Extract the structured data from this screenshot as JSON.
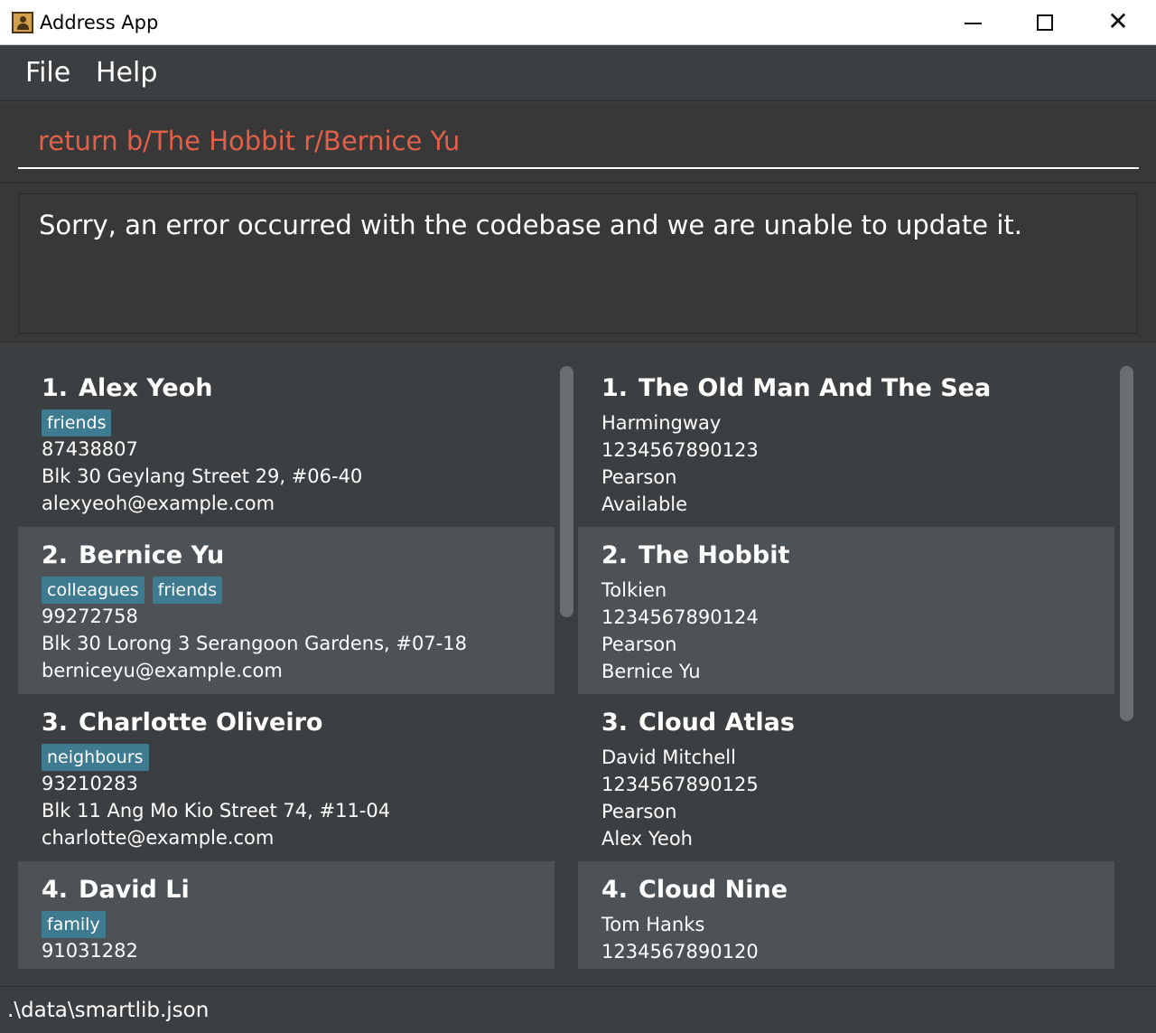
{
  "window": {
    "title": "Address App"
  },
  "menu": {
    "file": "File",
    "help": "Help"
  },
  "command": {
    "value": "return b/The Hobbit r/Bernice Yu"
  },
  "result": {
    "message": "Sorry, an error occurred with the codebase and we are unable to update it."
  },
  "persons": [
    {
      "index": "1.",
      "name": "Alex Yeoh",
      "tags": [
        "friends"
      ],
      "phone": "87438807",
      "address": "Blk 30 Geylang Street 29, #06-40",
      "email": "alexyeoh@example.com"
    },
    {
      "index": "2.",
      "name": "Bernice Yu",
      "tags": [
        "colleagues",
        "friends"
      ],
      "phone": "99272758",
      "address": "Blk 30 Lorong 3 Serangoon Gardens, #07-18",
      "email": "berniceyu@example.com"
    },
    {
      "index": "3.",
      "name": "Charlotte Oliveiro",
      "tags": [
        "neighbours"
      ],
      "phone": "93210283",
      "address": "Blk 11 Ang Mo Kio Street 74, #11-04",
      "email": "charlotte@example.com"
    },
    {
      "index": "4.",
      "name": "David Li",
      "tags": [
        "family"
      ],
      "phone": "91031282"
    }
  ],
  "books": [
    {
      "index": "1.",
      "title": "The Old Man And The Sea",
      "author": "Harmingway",
      "isbn": "1234567890123",
      "publisher": "Pearson",
      "status": "Available"
    },
    {
      "index": "2.",
      "title": "The Hobbit",
      "author": "Tolkien",
      "isbn": "1234567890124",
      "publisher": "Pearson",
      "status": "Bernice Yu"
    },
    {
      "index": "3.",
      "title": "Cloud Atlas",
      "author": "David Mitchell",
      "isbn": "1234567890125",
      "publisher": "Pearson",
      "status": "Alex Yeoh"
    },
    {
      "index": "4.",
      "title": "Cloud Nine",
      "author": "Tom Hanks",
      "isbn": "1234567890120"
    }
  ],
  "status": {
    "file_path": ".\\data\\smartlib.json"
  }
}
